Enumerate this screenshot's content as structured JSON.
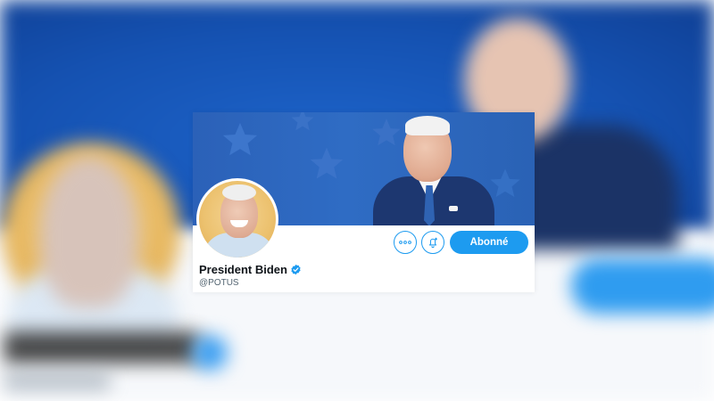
{
  "profile": {
    "display_name": "President Biden",
    "handle": "@POTUS",
    "verified": true
  },
  "actions": {
    "more_icon": "more-dots-icon",
    "notifications_icon": "bell-plus-icon",
    "follow_label": "Abonné"
  },
  "colors": {
    "accent": "#1d9bf0",
    "banner": "#2b61b8",
    "avatar_background": "#ecc16e",
    "name_text": "#0f1419",
    "handle_text": "#536471"
  }
}
